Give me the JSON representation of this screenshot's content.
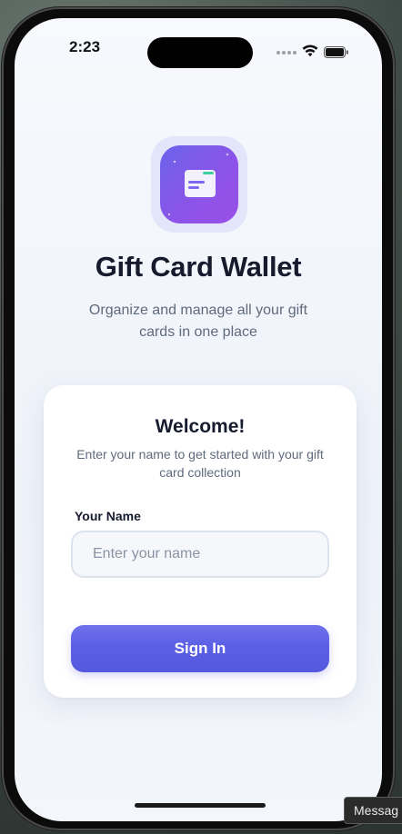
{
  "status_bar": {
    "time": "2:23"
  },
  "app": {
    "icon": "gift-card-wallet-icon",
    "title": "Gift Card Wallet",
    "subtitle": "Organize and manage all your gift cards in one place"
  },
  "card": {
    "heading": "Welcome!",
    "description": "Enter your name to get started with your gift card collection",
    "name_label": "Your Name",
    "name_value": "",
    "name_placeholder": "Enter your name",
    "sign_in_label": "Sign In"
  },
  "tooltip": {
    "text": "Messag"
  },
  "colors": {
    "accent": "#5b5fe5",
    "icon_gradient_start": "#6a63ea",
    "icon_gradient_end": "#9a4fe6",
    "title_text": "#151a2d",
    "muted_text": "#5f6a7d"
  }
}
